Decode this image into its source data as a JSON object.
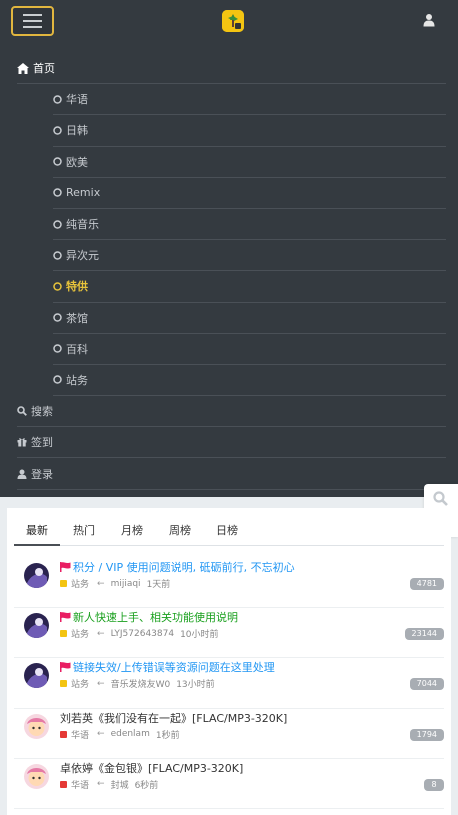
{
  "header": {
    "menu_toggle": "menu",
    "logo_icon": "app-logo",
    "user_icon": "user-icon"
  },
  "menu": {
    "home": "首页",
    "categories": [
      "华语",
      "日韩",
      "欧美",
      "Remix",
      "纯音乐",
      "异次元",
      "特供",
      "茶馆",
      "百科",
      "站务"
    ],
    "active": "特供",
    "search": "搜索",
    "checkin": "签到",
    "login": "登录"
  },
  "tabs": [
    "最新",
    "热门",
    "月榜",
    "周榜",
    "日榜"
  ],
  "active_tab": "最新",
  "posts": [
    {
      "title": "积分 / VIP 使用问题说明, 砥砺前行, 不忘初心",
      "pinned": true,
      "title_color": "#2196f3",
      "category": "站务",
      "category_color": "#f3c412",
      "author": "mijiaqi",
      "time": "1天前",
      "count": "4781"
    },
    {
      "title": "新人快速上手、相关功能使用说明",
      "pinned": true,
      "title_color": "#1aa01e",
      "category": "站务",
      "category_color": "#f3c412",
      "author": "LYJ572643874",
      "time": "10小时前",
      "count": "23144"
    },
    {
      "title": "链接失效/上传错误等资源问题在这里处理",
      "pinned": true,
      "title_color": "#2196f3",
      "category": "站务",
      "category_color": "#f3c412",
      "author": "音乐发烧友W0",
      "time": "13小时前",
      "count": "7044"
    },
    {
      "title": "刘若英《我们没有在一起》[FLAC/MP3-320K]",
      "pinned": false,
      "title_color": "#333333",
      "category": "华语",
      "category_color": "#e53935",
      "author": "edenlam",
      "time": "1秒前",
      "count": "1794"
    },
    {
      "title": "卓依婷《金包银》[FLAC/MP3-320K]",
      "pinned": false,
      "title_color": "#333333",
      "category": "华语",
      "category_color": "#e53935",
      "author": "封城",
      "time": "6秒前",
      "count": "8"
    }
  ],
  "colors": {
    "nav_bg": "#343a40",
    "accent": "#e8c43b",
    "pin_flag": "#e91e63"
  }
}
